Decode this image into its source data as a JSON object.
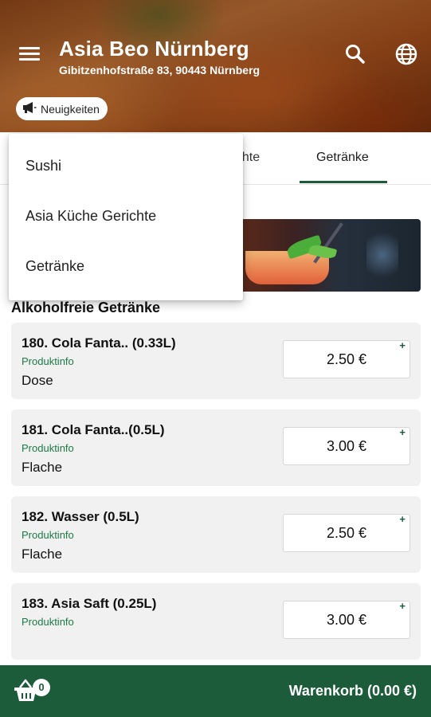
{
  "header": {
    "title": "Asia Beo Nürnberg",
    "address": "Gibitzenhofstraße 83, 90443 Nürnberg",
    "news_label": "Neuigkeiten",
    "icons": [
      "menu-icon",
      "search-icon",
      "globe-icon",
      "megaphone-icon"
    ]
  },
  "tabs": [
    {
      "label": "richte"
    },
    {
      "label": "Getränke",
      "active": true
    }
  ],
  "dropdown": {
    "items": [
      {
        "label": "Sushi"
      },
      {
        "label": "Asia Küche Gerichte"
      },
      {
        "label": "Getränke"
      }
    ]
  },
  "section": {
    "title": "Alkoholfreie Getränke"
  },
  "products": [
    {
      "name": "180. Cola Fanta.. (0.33L)",
      "info": "Produktinfo",
      "variant": "Dose",
      "price": "2.50 €"
    },
    {
      "name": "181. Cola Fanta..(0.5L)",
      "info": "Produktinfo",
      "variant": "Flache",
      "price": "3.00 €"
    },
    {
      "name": "182. Wasser (0.5L)",
      "info": "Produktinfo",
      "variant": "Flache",
      "price": "2.50 €"
    },
    {
      "name": "183. Asia Saft (0.25L)",
      "info": "Produktinfo",
      "variant": "",
      "price": "3.00 €"
    }
  ],
  "add_symbol": "+",
  "footer": {
    "cart_count": "0",
    "cart_label": "Warenkorb (0.00 €)"
  },
  "colors": {
    "brand_green": "#1d5c3a",
    "info_green": "#1d7a46",
    "card_bg": "#f1f1f1"
  }
}
